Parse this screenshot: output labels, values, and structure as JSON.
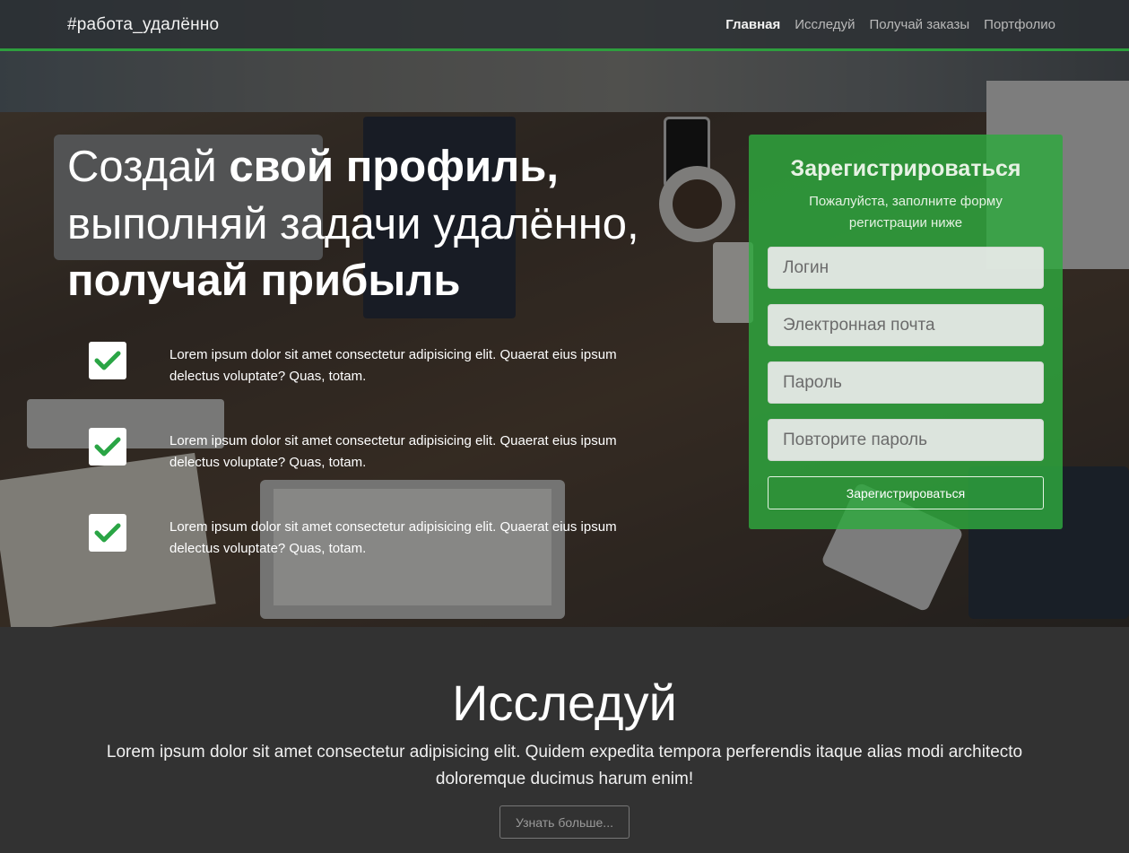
{
  "navbar": {
    "brand": "#работа_удалённо",
    "links": [
      {
        "label": "Главная",
        "active": true
      },
      {
        "label": "Исследуй",
        "active": false
      },
      {
        "label": "Получай заказы",
        "active": false
      },
      {
        "label": "Портфолио",
        "active": false
      }
    ],
    "accent_color": "#2e9e3e"
  },
  "hero": {
    "headline": {
      "part1": "Создай ",
      "part2_bold": "свой профиль,",
      "part3": "выполняй задачи удалённо,",
      "part4_bold": "получай прибыль"
    },
    "features": [
      {
        "icon": "checkmark-icon",
        "text": "Lorem ipsum dolor sit amet consectetur adipisicing elit. Quaerat eius ipsum delectus voluptate? Quas, totam."
      },
      {
        "icon": "checkmark-icon",
        "text": "Lorem ipsum dolor sit amet consectetur adipisicing elit. Quaerat eius ipsum delectus voluptate? Quas, totam."
      },
      {
        "icon": "checkmark-icon",
        "text": "Lorem ipsum dolor sit amet consectetur adipisicing elit. Quaerat eius ipsum delectus voluptate? Quas, totam."
      }
    ]
  },
  "registration": {
    "title": "Зарегистрироваться",
    "subtitle": "Пожалуйста, заполните форму регистрации ниже",
    "login_placeholder": "Логин",
    "email_placeholder": "Электронная почта",
    "password_placeholder": "Пароль",
    "password_repeat_placeholder": "Повторите пароль",
    "submit_label": "Зарегистрироваться",
    "panel_color": "#2eaa3e"
  },
  "explore": {
    "title": "Исследуй",
    "text": "Lorem ipsum dolor sit amet consectetur adipisicing elit. Quidem expedita tempora perferendis itaque alias modi architecto doloremque ducimus harum enim!",
    "button_label": "Узнать больше..."
  }
}
